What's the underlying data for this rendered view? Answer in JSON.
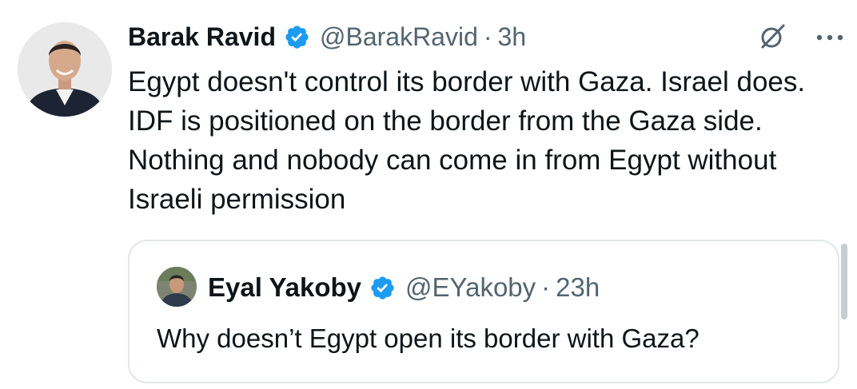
{
  "tweet": {
    "author": {
      "name": "Barak Ravid",
      "handle": "@BarakRavid",
      "verified": true,
      "avatar": "person-portrait"
    },
    "separator": "·",
    "time": "3h",
    "actions": {
      "grok_icon": "grok-icon",
      "more_icon": "more-icon"
    },
    "text": "Egypt doesn't control its border with Gaza. Israel does. IDF is positioned on the border from the Gaza side. Nothing and nobody can come in from Egypt without Israeli permission"
  },
  "quote": {
    "author": {
      "name": "Eyal Yakoby",
      "handle": "@EYakoby",
      "verified": true,
      "avatar": "person-portrait"
    },
    "separator": "·",
    "time": "23h",
    "text": "Why doesn’t Egypt open its border with Gaza?"
  },
  "colors": {
    "text": "#0f1419",
    "secondary": "#536471",
    "verified": "#1d9bf0",
    "border": "#e3e7ea"
  }
}
